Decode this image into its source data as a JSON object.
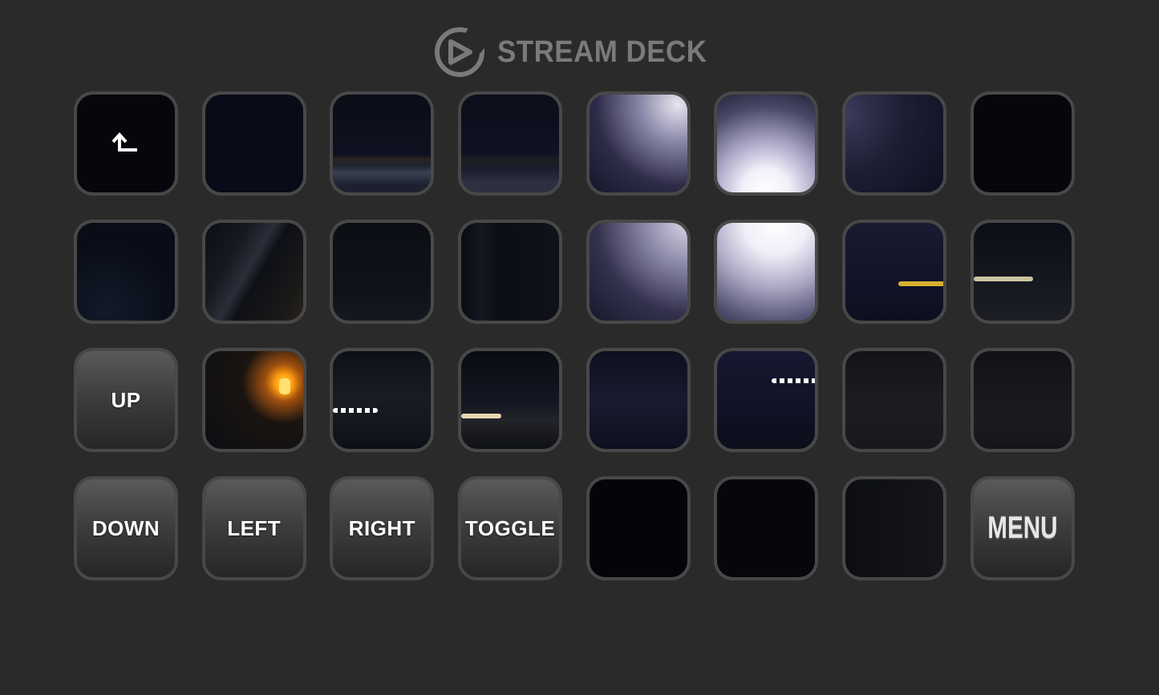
{
  "header": {
    "brand": "STREAM DECK",
    "logo_icon": "elgato-logo-icon"
  },
  "keys": [
    {
      "name": "back-key",
      "icon": "back-arrow-icon",
      "label": "",
      "style": "t-black"
    },
    {
      "name": "camera-tile-key",
      "label": "",
      "style": "t-dark1"
    },
    {
      "name": "camera-tile-key",
      "label": "",
      "style": "t-road1"
    },
    {
      "name": "camera-tile-key",
      "label": "",
      "style": "t-road2"
    },
    {
      "name": "camera-tile-key",
      "label": "",
      "style": "t-glow1"
    },
    {
      "name": "camera-tile-key",
      "label": "",
      "style": "t-glow2"
    },
    {
      "name": "camera-tile-key",
      "label": "",
      "style": "t-glow3"
    },
    {
      "name": "camera-tile-key",
      "label": "",
      "style": "t-black"
    },
    {
      "name": "camera-tile-key",
      "label": "",
      "style": "t-night"
    },
    {
      "name": "camera-tile-key",
      "label": "",
      "style": "t-win"
    },
    {
      "name": "camera-tile-key",
      "label": "",
      "style": "t-int1"
    },
    {
      "name": "camera-tile-key",
      "label": "",
      "style": "t-int2"
    },
    {
      "name": "camera-tile-key",
      "label": "",
      "style": "t-glow4"
    },
    {
      "name": "camera-tile-key",
      "label": "",
      "style": "t-glow5"
    },
    {
      "name": "camera-tile-key",
      "label": "",
      "style": "t-glow6",
      "accent": "streak-yellow"
    },
    {
      "name": "camera-tile-key",
      "label": "",
      "style": "t-streak",
      "accent": "streak-white"
    },
    {
      "name": "up-key",
      "label": "UP",
      "style": "label"
    },
    {
      "name": "camera-tile-key",
      "label": "",
      "style": "t-amber",
      "accent": "amber"
    },
    {
      "name": "camera-tile-key",
      "label": "",
      "style": "t-ledA",
      "accent": "dots-left"
    },
    {
      "name": "camera-tile-key",
      "label": "",
      "style": "t-ledB",
      "accent": "streak-warm"
    },
    {
      "name": "camera-tile-key",
      "label": "",
      "style": "t-ledC"
    },
    {
      "name": "camera-tile-key",
      "label": "",
      "style": "t-ledD",
      "accent": "dots-right"
    },
    {
      "name": "camera-tile-key",
      "label": "",
      "style": "t-grey1"
    },
    {
      "name": "camera-tile-key",
      "label": "",
      "style": "t-grey2"
    },
    {
      "name": "down-key",
      "label": "DOWN",
      "style": "label"
    },
    {
      "name": "left-key",
      "label": "LEFT",
      "style": "label"
    },
    {
      "name": "right-key",
      "label": "RIGHT",
      "style": "label"
    },
    {
      "name": "toggle-key",
      "label": "TOGGLE",
      "style": "label"
    },
    {
      "name": "camera-tile-key",
      "label": "",
      "style": "t-vblack"
    },
    {
      "name": "camera-tile-key",
      "label": "",
      "style": "t-vblack2"
    },
    {
      "name": "camera-tile-key",
      "label": "",
      "style": "t-vblack3"
    },
    {
      "name": "menu-key",
      "label": "MENU",
      "style": "label",
      "variant": "menu"
    }
  ],
  "colors": {
    "background": "#2a2a2a",
    "key_border": "#484848",
    "brand_text": "#7a7a7a"
  }
}
